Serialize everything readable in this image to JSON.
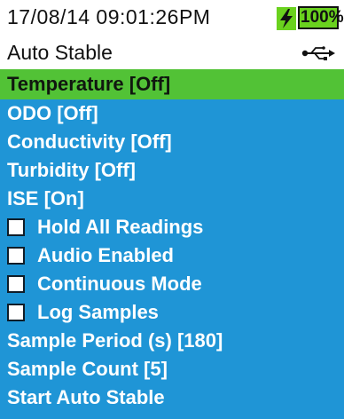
{
  "status": {
    "datetime": "17/08/14  09:01:26PM",
    "battery_percent": "100%",
    "battery_icon": "battery-icon",
    "charging_icon": "bolt-icon"
  },
  "header": {
    "title": "Auto Stable",
    "connection_icon": "usb-icon"
  },
  "menu": {
    "items": [
      {
        "label": "Temperature [Off]",
        "selected": true
      },
      {
        "label": "ODO [Off]"
      },
      {
        "label": "Conductivity [Off]"
      },
      {
        "label": "Turbidity [Off]"
      },
      {
        "label": "ISE [On]"
      },
      {
        "label": "Hold All Readings",
        "checkbox": true,
        "checked": false
      },
      {
        "label": "Audio Enabled",
        "checkbox": true,
        "checked": false
      },
      {
        "label": "Continuous Mode",
        "checkbox": true,
        "checked": false
      },
      {
        "label": "Log Samples",
        "checkbox": true,
        "checked": false
      },
      {
        "label": "Sample Period (s) [180]"
      },
      {
        "label": "Sample Count [5]"
      },
      {
        "label": "Start Auto Stable"
      }
    ]
  },
  "colors": {
    "menu_background": "#1f95d6",
    "selected_background": "#52c236",
    "battery_fill": "#6ad21e"
  }
}
